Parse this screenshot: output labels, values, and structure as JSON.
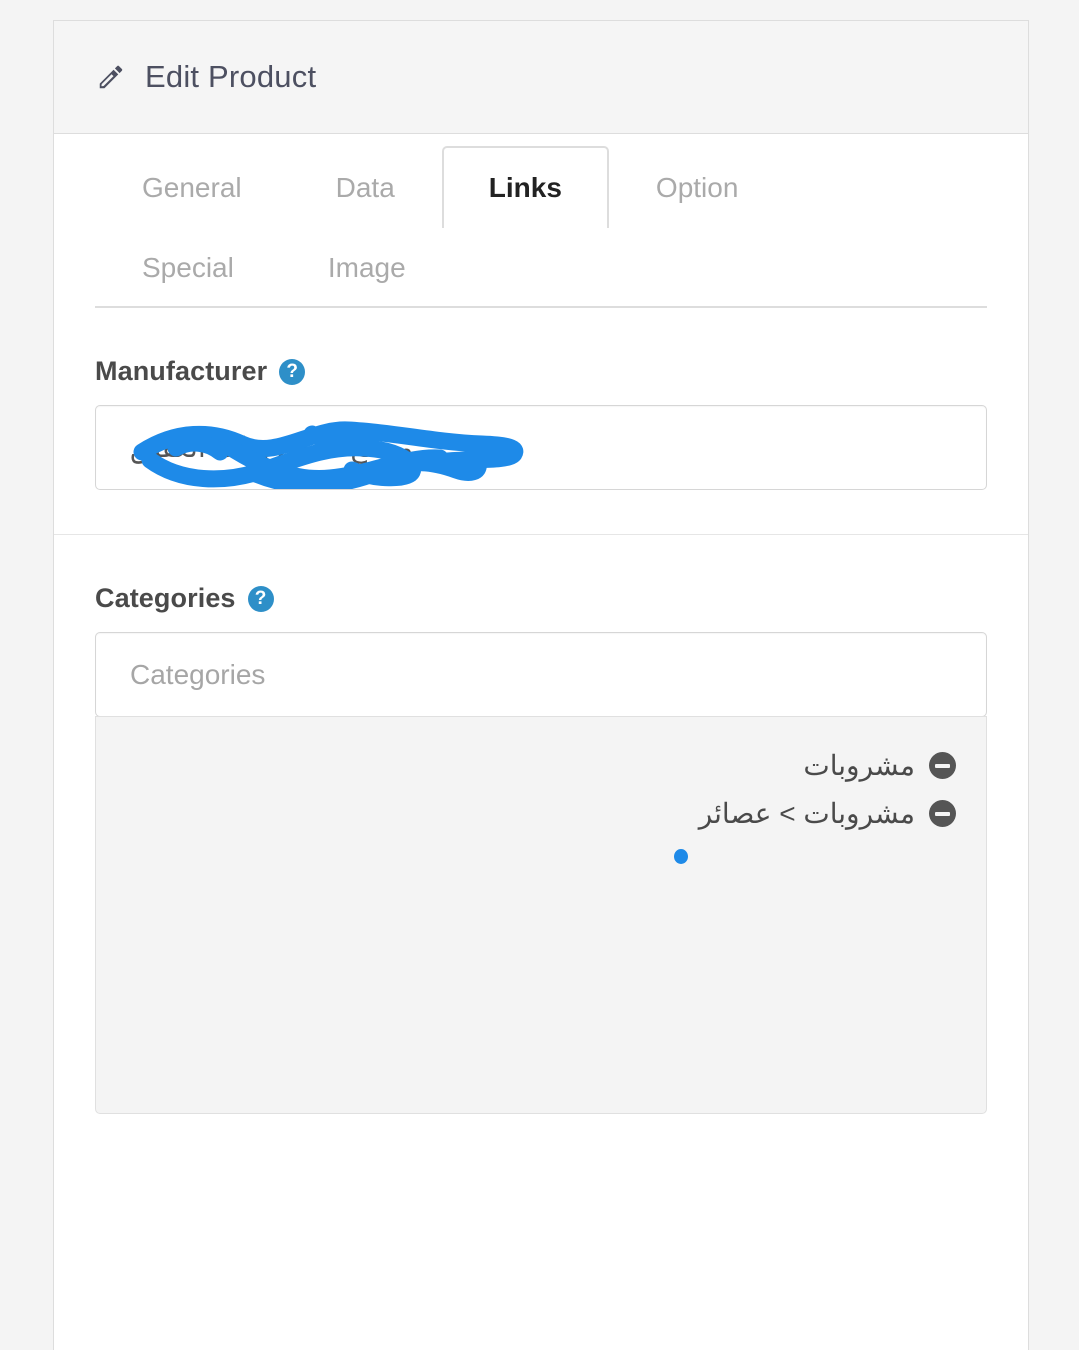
{
  "window": {
    "background_color": "#f4f4f4"
  },
  "card": {
    "header": {
      "icon": "pencil-icon",
      "title": "Edit Product",
      "background_color": "#f5f5f5"
    }
  },
  "tabs": [
    {
      "label": "General",
      "active": false
    },
    {
      "label": "Data",
      "active": false
    },
    {
      "label": "Links",
      "active": true
    },
    {
      "label": "Option",
      "active": false
    },
    {
      "label": "Special",
      "active": false
    },
    {
      "label": "Image",
      "active": false
    }
  ],
  "form": {
    "manufacturer": {
      "label": "Manufacturer",
      "help_icon": "question-circle-icon",
      "help_icon_color": "#2e8fc8",
      "value": "مصنع المشروبات العقيق",
      "redacted": true,
      "redaction_color": "#1e8ae8"
    },
    "categories": {
      "label": "Categories",
      "help_icon": "question-circle-icon",
      "help_icon_color": "#2e8fc8",
      "input_value": "",
      "placeholder": "Categories",
      "selected": [
        {
          "label": "مشروبات",
          "remove_icon": "minus-circle-icon"
        },
        {
          "label": "مشروبات > عصائر",
          "remove_icon": "minus-circle-icon"
        }
      ],
      "annotation_dot_color": "#1e8ae8"
    }
  }
}
